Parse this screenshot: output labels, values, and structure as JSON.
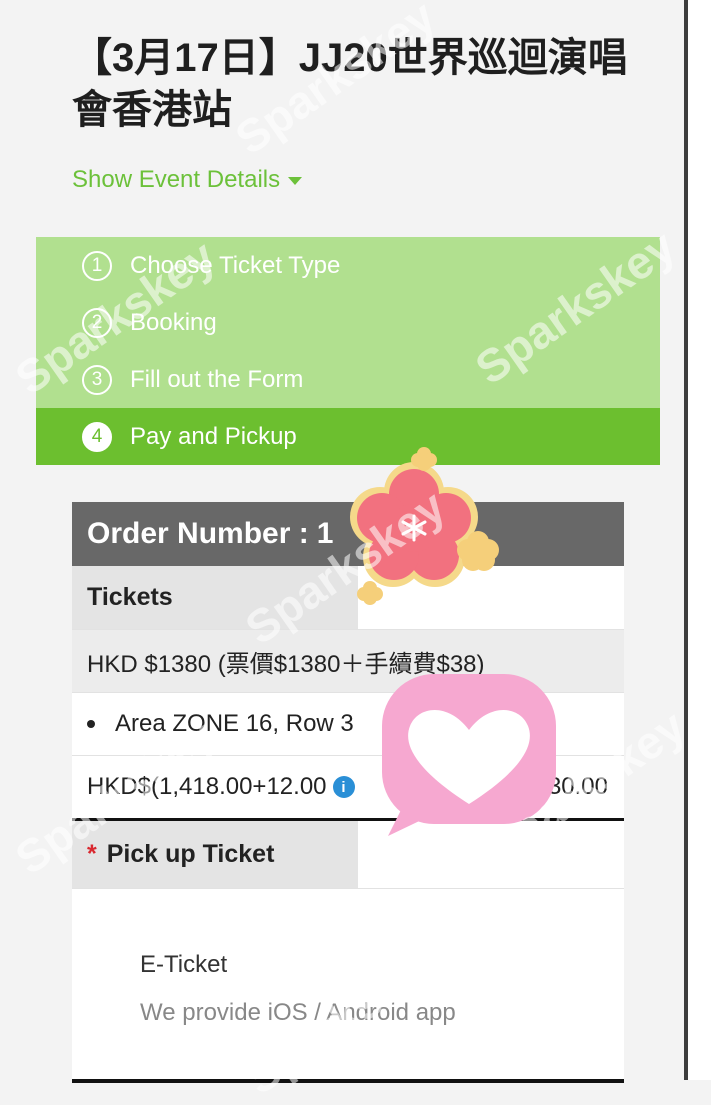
{
  "event": {
    "title": "【3月17日】JJ20世界巡迴演唱會香港站",
    "details_toggle": "Show Event Details"
  },
  "steps": [
    {
      "num": "1",
      "label": "Choose Ticket Type",
      "active": false
    },
    {
      "num": "2",
      "label": "Booking",
      "active": false
    },
    {
      "num": "3",
      "label": "Fill out the Form",
      "active": false
    },
    {
      "num": "4",
      "label": "Pay and Pickup",
      "active": true
    }
  ],
  "order": {
    "header_label": "Order Number :",
    "number_visible": "1"
  },
  "tickets": {
    "section_label": "Tickets",
    "price_line": "HKD $1380 (票價$1380＋手續費$38)",
    "seat_line": "Area ZONE 16, Row 3",
    "total_left": "HKD$(1,418.00+12.00",
    "info_icon_glyph": "i",
    "total_right": "30.00"
  },
  "pickup": {
    "section_label": "Pick up Ticket",
    "required_marker": "*",
    "method": "E-Ticket",
    "description": "We provide iOS / Android app"
  },
  "watermark": "Sparkskey",
  "colors": {
    "accent_green": "#6cbf2f",
    "light_green": "#b1e08f",
    "header_gray": "#686868",
    "info_blue": "#2a8fd6"
  },
  "icons": [
    "caret-down-icon",
    "info-icon",
    "flower-sticker",
    "heart-bubble-sticker"
  ]
}
